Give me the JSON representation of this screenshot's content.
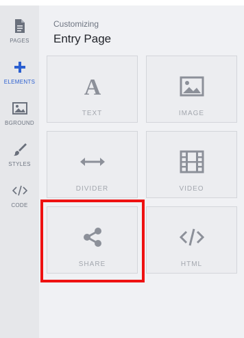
{
  "sidebar": {
    "items": [
      {
        "label": "PAGES",
        "icon": "page-icon",
        "active": false
      },
      {
        "label": "ELEMENTS",
        "icon": "plus-icon",
        "active": true
      },
      {
        "label": "BGROUND",
        "icon": "image-icon",
        "active": false
      },
      {
        "label": "STYLES",
        "icon": "brush-icon",
        "active": false
      },
      {
        "label": "CODE",
        "icon": "code-icon",
        "active": false
      }
    ]
  },
  "panel": {
    "subtitle": "Customizing",
    "title": "Entry Page"
  },
  "elements": [
    {
      "label": "TEXT",
      "icon": "text-icon"
    },
    {
      "label": "IMAGE",
      "icon": "image-icon"
    },
    {
      "label": "DIVIDER",
      "icon": "divider-icon"
    },
    {
      "label": "VIDEO",
      "icon": "film-icon"
    },
    {
      "label": "SHARE",
      "icon": "share-icon"
    },
    {
      "label": "HTML",
      "icon": "code-icon"
    }
  ],
  "colors": {
    "accent": "#2b5fd0",
    "highlight": "#ee1111"
  }
}
